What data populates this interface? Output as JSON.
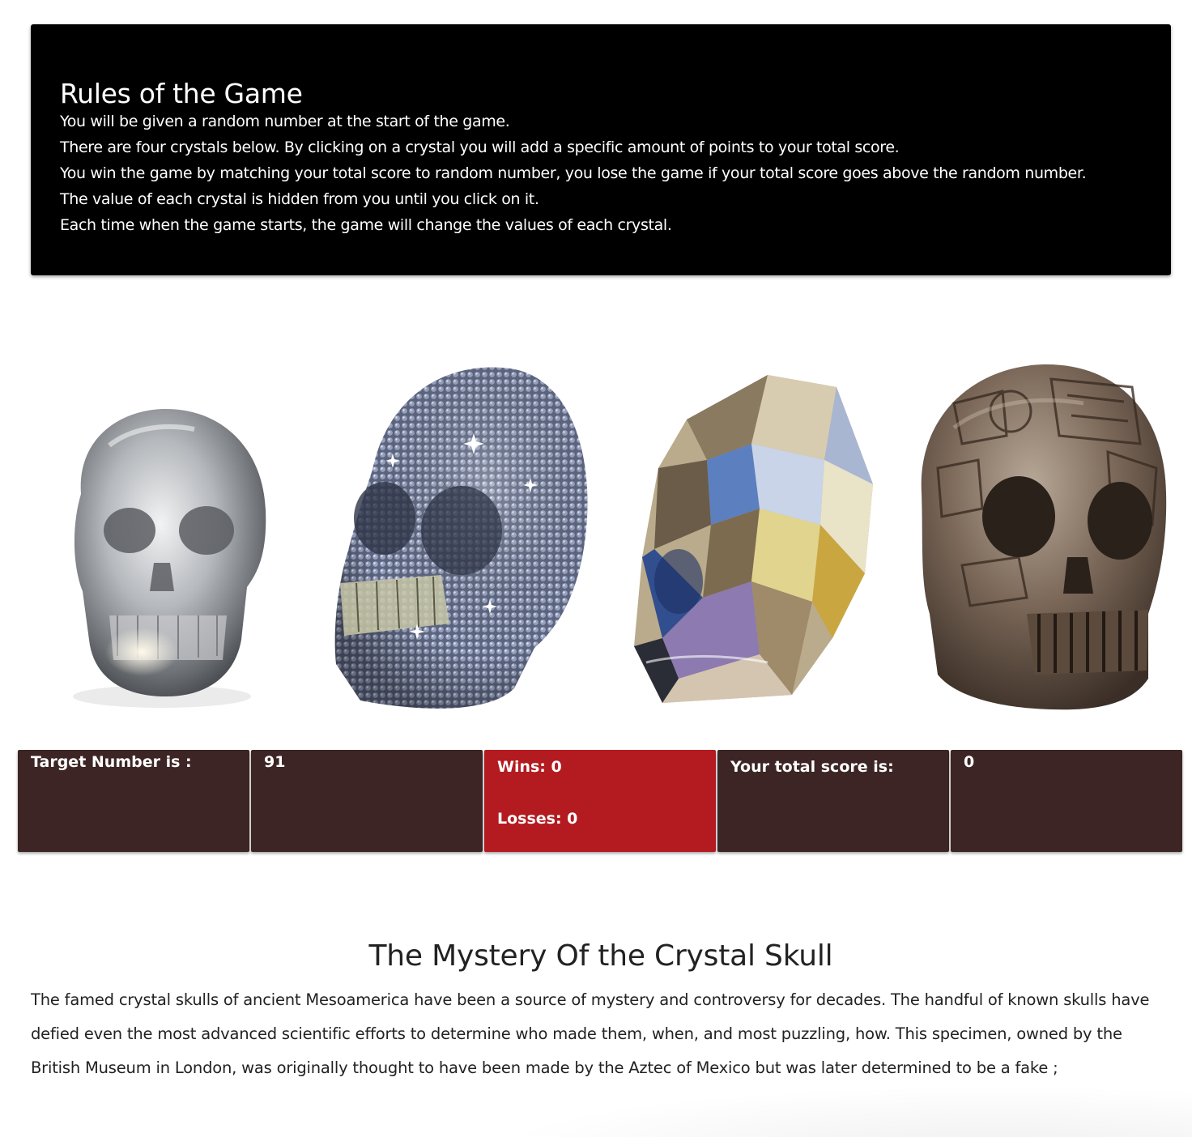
{
  "rules": {
    "title": "Rules of the Game",
    "lines": [
      "You will be given a random number at the start of the game.",
      "There are four crystals below. By clicking on a crystal you will add a specific amount of points to your total score.",
      "You win the game by matching your total score to random number, you lose the game if your total score goes above the random number.",
      "The value of each crystal is hidden from you until you click on it.",
      "Each time when the game starts, the game will change the values of each crystal."
    ]
  },
  "crystals": [
    {
      "icon": "clear-quartz-skull-icon"
    },
    {
      "icon": "rhinestone-skull-icon"
    },
    {
      "icon": "faceted-crystal-skull-icon"
    },
    {
      "icon": "aztec-bronze-skull-icon"
    }
  ],
  "scoreboard": {
    "target_label": "Target Number is :",
    "target_value": "91",
    "wins_label": "Wins: 0",
    "losses_label": "Losses: 0",
    "score_label": "Your total score is:",
    "score_value": "0"
  },
  "colors": {
    "rules_bg": "#000000",
    "cell_bg": "#3c2524",
    "record_bg": "#b31b20"
  },
  "mystery": {
    "title": "The Mystery Of the Crystal Skull",
    "text": "The famed crystal skulls of ancient Mesoamerica have been a source of mystery and controversy for decades. The handful of known skulls have defied even the most advanced scientific efforts to determine who made them, when, and most puzzling, how. This specimen, owned by the British Museum in London, was originally thought to have been made by the Aztec of Mexico but was later determined to be a fake ;"
  }
}
